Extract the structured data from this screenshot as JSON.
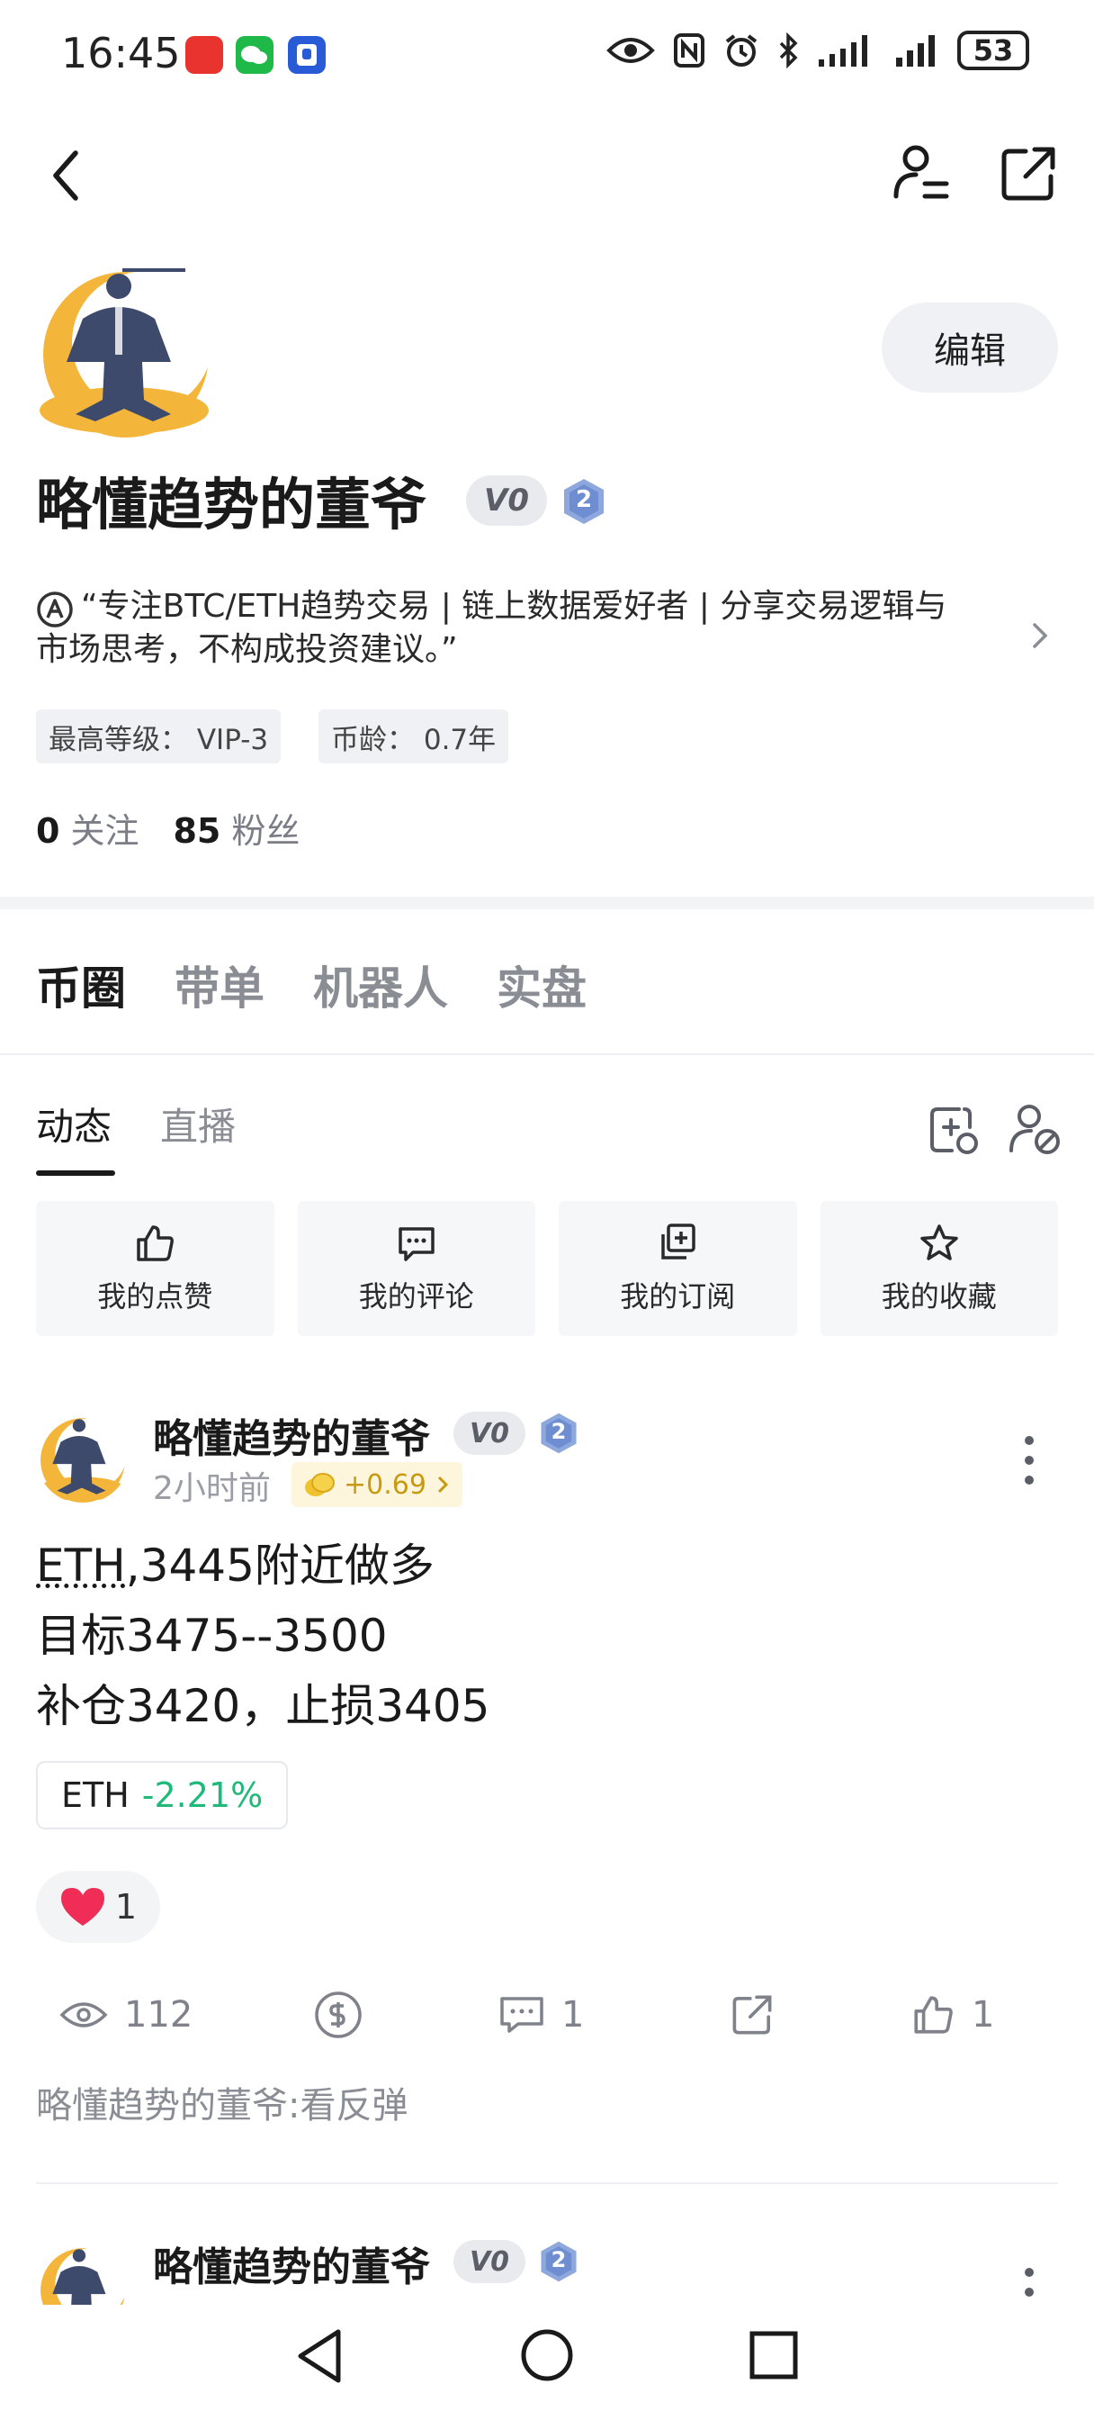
{
  "status_bar": {
    "time": "16:45",
    "battery": "53",
    "icons": [
      "huawei-app-icon",
      "wechat-icon",
      "calendar-app-icon",
      "eye-icon",
      "nfc-icon",
      "alarm-icon",
      "bluetooth-icon",
      "signal-icon",
      "signal-icon",
      "battery-icon"
    ]
  },
  "header": {
    "icons": [
      "back-icon",
      "user-settings-icon",
      "share-icon"
    ]
  },
  "profile": {
    "edit_label": "编辑",
    "name": "略懂趋势的董爷",
    "vip_label": "V0",
    "level": "2",
    "bio": "“专注BTC/ETH趋势交易 | 链上数据爱好者 | 分享交易逻辑与市场思考，不构成投资建议。”",
    "tags": [
      "最高等级：  VIP-3",
      "币龄：  0.7年"
    ],
    "following_count": "0",
    "following_label": "关注",
    "followers_count": "85",
    "followers_label": "粉丝"
  },
  "main_tabs": [
    "币圈",
    "带单",
    "机器人",
    "实盘"
  ],
  "sub_tabs": [
    "动态",
    "直播"
  ],
  "quick_actions": [
    {
      "label": "我的点赞",
      "icon": "thumbs-up-icon"
    },
    {
      "label": "我的评论",
      "icon": "comment-icon"
    },
    {
      "label": "我的订阅",
      "icon": "subscribe-icon"
    },
    {
      "label": "我的收藏",
      "icon": "star-icon"
    }
  ],
  "post": {
    "author": "略懂趋势的董爷",
    "vip_label": "V0",
    "level": "2",
    "time": "2小时前",
    "coin_reward": "+0.69",
    "body_line1_ticker": "ETH",
    "body_line1_rest": ",3445附近做多",
    "body_line2": "目标3475--3500",
    "body_line3": "补仓3420，止损3405",
    "ticker_symbol": "ETH",
    "ticker_change": "-2.21%",
    "reaction_count": "1",
    "views": "112",
    "comments": "1",
    "likes": "1",
    "comment_preview": "略懂趋势的董爷:看反弹"
  },
  "post2": {
    "author": "略懂趋势的董爷",
    "vip_label": "V0",
    "level": "2"
  },
  "colors": {
    "accent_green": "#21b97a",
    "coin_gold": "#c89a12",
    "heart": "#ef2d56"
  }
}
